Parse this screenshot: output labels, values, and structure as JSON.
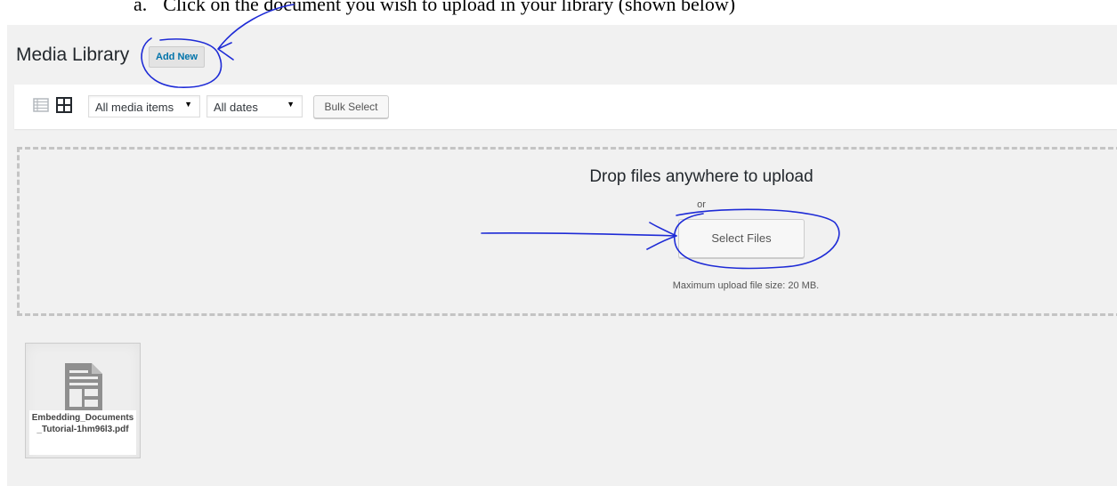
{
  "instruction": {
    "number": "a.",
    "text": "Click on the document you wish to upload in your library (shown below)"
  },
  "header": {
    "title": "Media Library",
    "add_new_label": "Add New"
  },
  "toolbar": {
    "view_list_icon": "list-view-icon",
    "view_grid_icon": "grid-view-icon",
    "filter_type_value": "All media items",
    "filter_date_value": "All dates",
    "bulk_select_label": "Bulk Select"
  },
  "uploader": {
    "title": "Drop files anywhere to upload",
    "or_text": "or",
    "select_files_label": "Select Files",
    "max_size_text": "Maximum upload file size: 20 MB."
  },
  "attachments": [
    {
      "icon": "document-icon",
      "filename": "Embedding_Documents_Tutorial-1hm96l3.pdf"
    }
  ],
  "annotation_color": "#1e2bd6"
}
